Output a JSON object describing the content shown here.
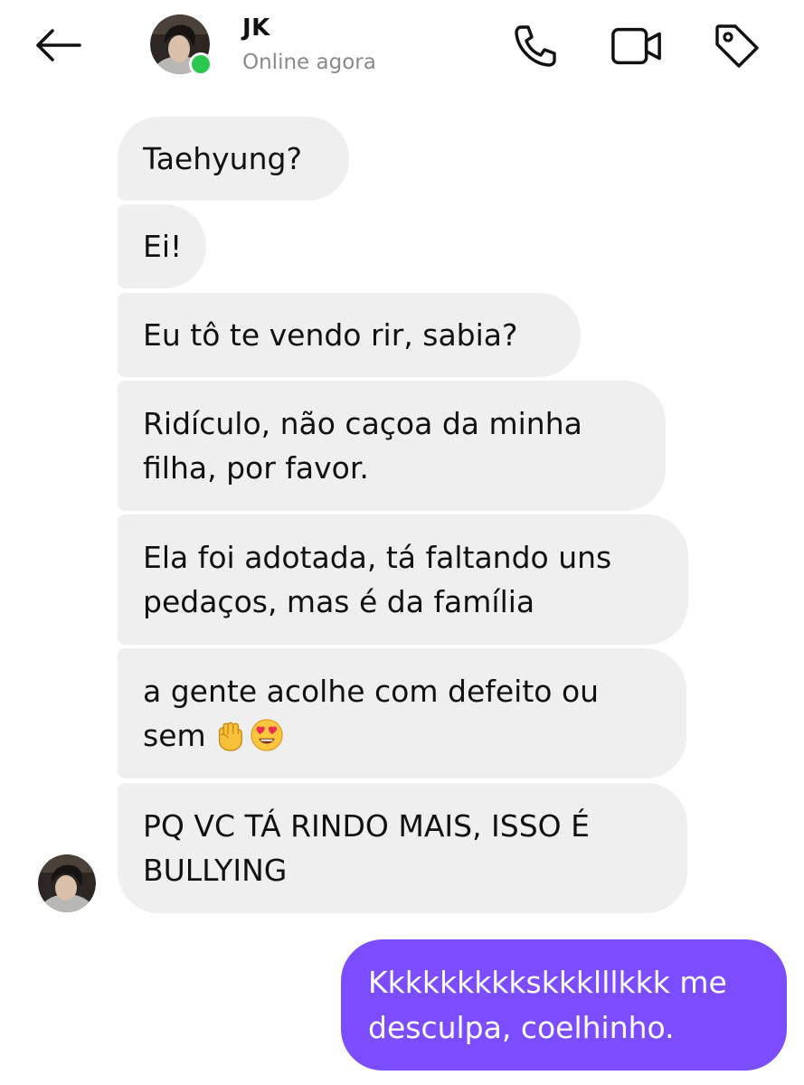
{
  "header": {
    "back_icon": "arrow-left-icon",
    "contact_name": "JK",
    "status": "Online agora",
    "status_dot_color": "#2cc84d",
    "actions": [
      {
        "icon": "phone-icon"
      },
      {
        "icon": "video-camera-icon"
      },
      {
        "icon": "tag-icon"
      }
    ]
  },
  "messages": [
    {
      "from": "contact",
      "text": "Taehyung?"
    },
    {
      "from": "contact",
      "text": "Ei!"
    },
    {
      "from": "contact",
      "text": "Eu tô te vendo rir, sabia?"
    },
    {
      "from": "contact",
      "text": "Ridículo, não caçoa da minha filha, por favor."
    },
    {
      "from": "contact",
      "text": "Ela foi adotada, tá faltando uns pedaços, mas é da família"
    },
    {
      "from": "contact",
      "text": "a gente acolhe com defeito ou sem",
      "emojis": [
        "raised-fist-emoji",
        "heart-eyes-emoji"
      ]
    },
    {
      "from": "contact",
      "text": "PQ VC TÁ RINDO MAIS, ISSO É BULLYING"
    },
    {
      "from": "me",
      "text": "Kkkkkkkkkskkklllkkk me desculpa, coelhinho."
    }
  ],
  "colors": {
    "incoming_bubble": "#efefef",
    "outgoing_bubble": "#7c4dff",
    "outgoing_text": "#ffffff",
    "status_text": "#8a8a8a"
  }
}
